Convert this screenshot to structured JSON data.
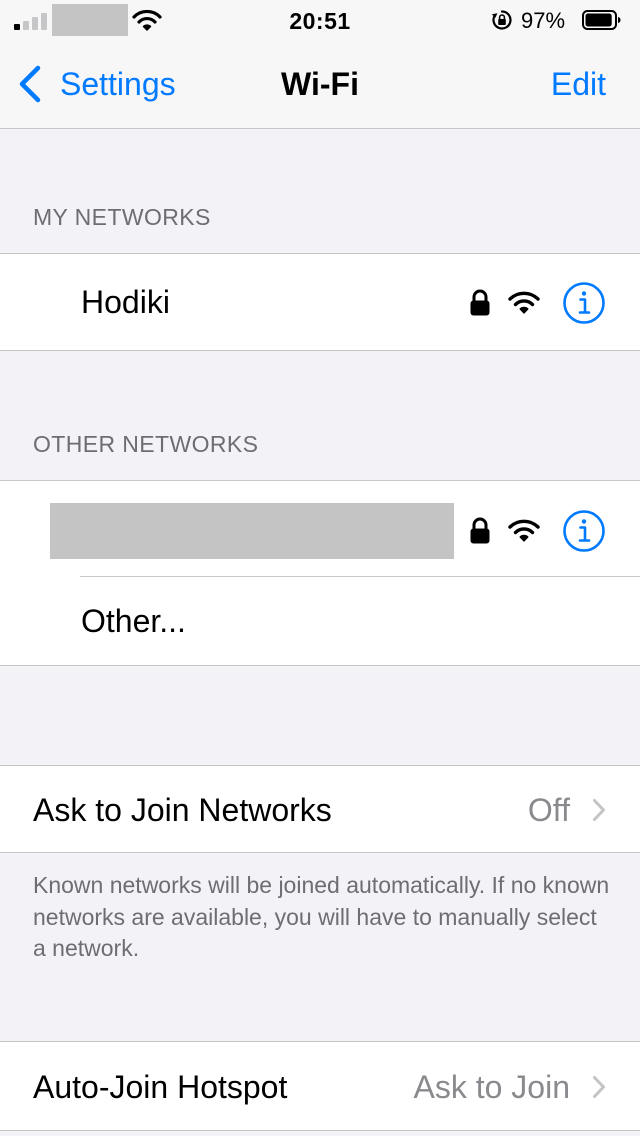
{
  "status_bar": {
    "time": "20:51",
    "battery_percent": "97%",
    "battery_level": 0.97,
    "signal_bars_active": 1,
    "signal_bars_total": 4
  },
  "nav": {
    "back_label": "Settings",
    "title": "Wi-Fi",
    "edit_label": "Edit"
  },
  "my_networks": {
    "header": "MY NETWORKS",
    "items": [
      {
        "name": "Hodiki",
        "secured": true
      }
    ]
  },
  "other_networks": {
    "header": "OTHER NETWORKS",
    "items": [
      {
        "name": "",
        "secured": true,
        "redacted": true
      }
    ],
    "other_label": "Other..."
  },
  "ask_to_join": {
    "label": "Ask to Join Networks",
    "value": "Off",
    "footer": "Known networks will be joined automatically. If no known networks are available, you will have to manually select a network."
  },
  "auto_join_hotspot": {
    "label": "Auto-Join Hotspot",
    "value": "Ask to Join"
  },
  "colors": {
    "accent": "#007aff",
    "background": "#f2f2f7",
    "secondary_text": "#6d6d72",
    "value_text": "#8a8a8e",
    "separator": "#c6c6c8"
  }
}
